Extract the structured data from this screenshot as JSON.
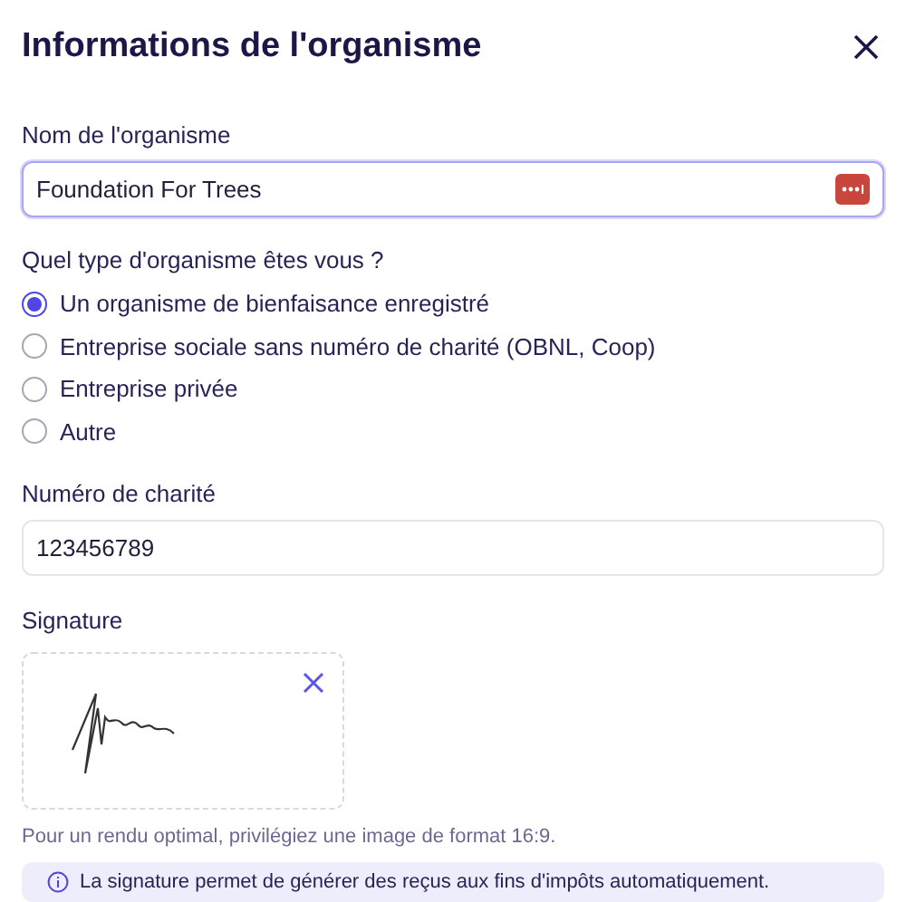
{
  "title": "Informations de l'organisme",
  "name_field": {
    "label": "Nom de l'organisme",
    "value": "Foundation For Trees",
    "focused": true
  },
  "type_question": {
    "label": "Quel type d'organisme êtes vous ?",
    "options": [
      {
        "label": "Un organisme de bienfaisance enregistré",
        "selected": true
      },
      {
        "label": "Entreprise sociale sans numéro de charité (OBNL, Coop)",
        "selected": false
      },
      {
        "label": "Entreprise privée",
        "selected": false
      },
      {
        "label": "Autre",
        "selected": false
      }
    ]
  },
  "charity_field": {
    "label": "Numéro de charité",
    "value": "123456789",
    "focused": false
  },
  "signature": {
    "label": "Signature",
    "hint": "Pour un rendu optimal, privilégiez une image de format 16:9.",
    "info": "La signature permet de générer des reçus aux fins d'impôts automatiquement."
  }
}
